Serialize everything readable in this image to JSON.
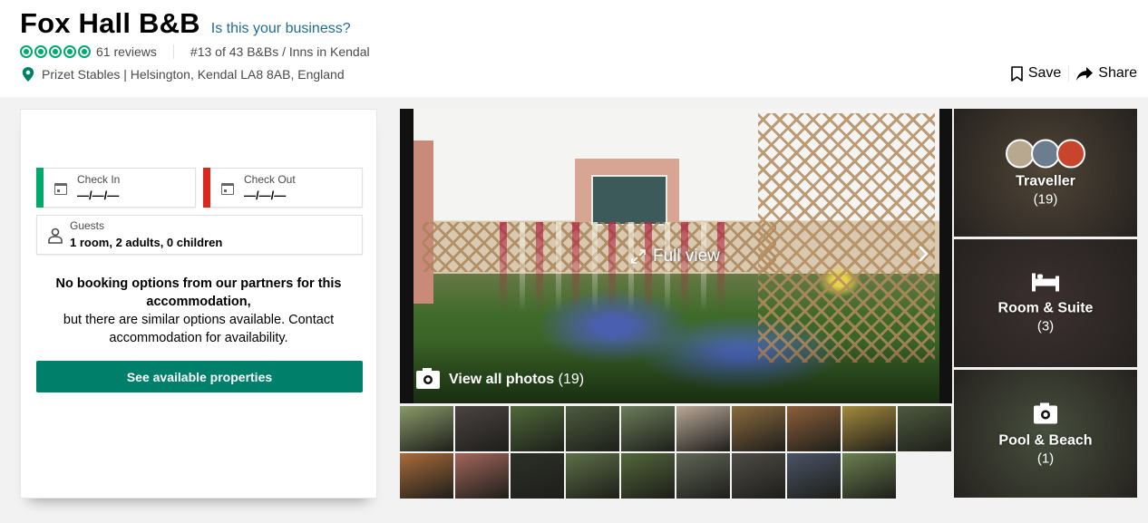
{
  "header": {
    "title": "Fox Hall B&B",
    "claim_link": "Is this your business?",
    "rating_bubbles": 5,
    "reviews": "61 reviews",
    "ranking": "#13 of 43 B&Bs / Inns in Kendal",
    "address": "Prizet Stables | Helsington, Kendal LA8 8AB, England",
    "save_label": "Save",
    "share_label": "Share"
  },
  "booking": {
    "check_in": {
      "label": "Check In",
      "value": "—/—/—",
      "accent": "#00aa6c"
    },
    "check_out": {
      "label": "Check Out",
      "value": "—/—/—",
      "accent": "#d8281f"
    },
    "guests": {
      "label": "Guests",
      "value": "1 room, 2 adults, 0 children"
    },
    "message_bold": "No booking options from our partners for this accommodation,",
    "message": "but there are similar options available. Contact accommodation for availability.",
    "cta_label": "See available properties",
    "cta_color": "#00806a"
  },
  "gallery": {
    "full_view_label": "Full view",
    "view_all_label": "View all photos",
    "view_all_count": "(19)",
    "thumbnails": [
      {
        "name": "garden-flowers",
        "color": "#8a9a6a"
      },
      {
        "name": "bedroom",
        "color": "#4a4342"
      },
      {
        "name": "vegetable-bed",
        "color": "#4e6a3a"
      },
      {
        "name": "garden-path",
        "color": "#4c5c3e"
      },
      {
        "name": "goats",
        "color": "#6b7d5a"
      },
      {
        "name": "we-are-vegans-sign",
        "color": "#b9a898"
      },
      {
        "name": "salad-plate",
        "color": "#8b6a3e"
      },
      {
        "name": "roast-vegetables",
        "color": "#8d5f3a"
      },
      {
        "name": "curry-dish",
        "color": "#a48a3c"
      },
      {
        "name": "window-view",
        "color": "#4d5a3e"
      },
      {
        "name": "breakfast-dish",
        "color": "#a96b3a"
      },
      {
        "name": "dessert-plate",
        "color": "#a2665a"
      },
      {
        "name": "window-frame",
        "color": "#2c2f28"
      },
      {
        "name": "countryside-field",
        "color": "#5d7048"
      },
      {
        "name": "garden-gate",
        "color": "#52673a"
      },
      {
        "name": "overcast-fields",
        "color": "#5f6656"
      },
      {
        "name": "bathroom",
        "color": "#4e4b46"
      },
      {
        "name": "evening-sky",
        "color": "#4a5466"
      },
      {
        "name": "green-valley",
        "color": "#6b8050"
      }
    ]
  },
  "categories": [
    {
      "name": "Traveller",
      "count": "(19)",
      "bg": "#7b6a55"
    },
    {
      "name": "Room & Suite",
      "count": "(3)",
      "bg": "#5b4a4a"
    },
    {
      "name": "Pool & Beach",
      "count": "(1)",
      "bg": "#6e7a5e"
    }
  ]
}
